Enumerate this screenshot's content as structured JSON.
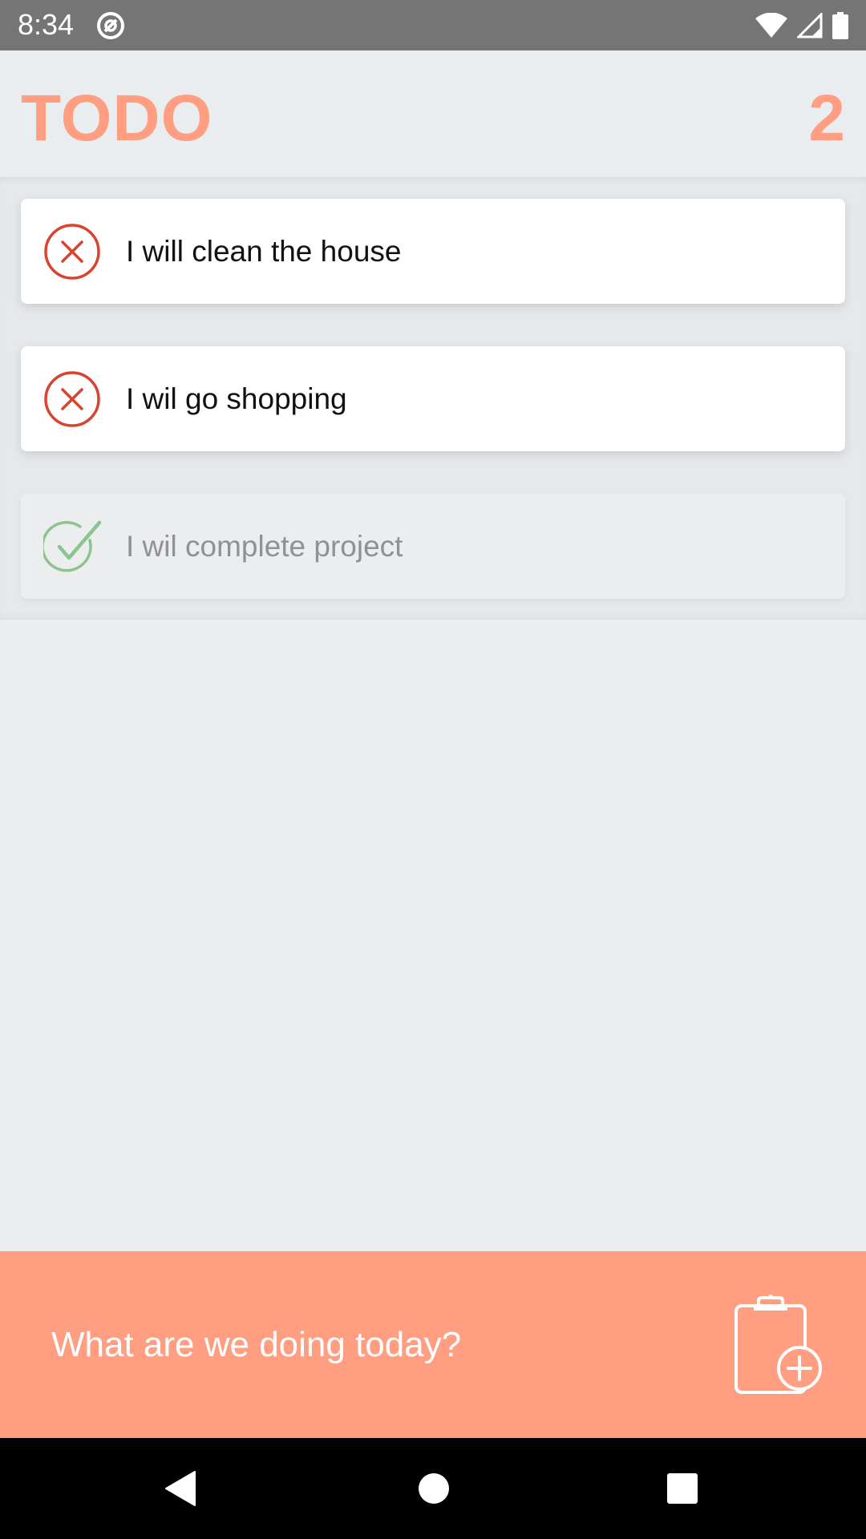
{
  "status_bar": {
    "time": "8:34"
  },
  "header": {
    "title": "TODO",
    "count": "2"
  },
  "todos": [
    {
      "text": "I will clean the house",
      "completed": false,
      "icon": "x-circle-icon"
    },
    {
      "text": "I wil go shopping",
      "completed": false,
      "icon": "x-circle-icon"
    },
    {
      "text": "I wil complete project",
      "completed": true,
      "icon": "check-circle-icon"
    }
  ],
  "input": {
    "placeholder": "What are we doing today?",
    "value": ""
  },
  "colors": {
    "accent": "#ff9e80",
    "pending_icon": "#d9432f",
    "done_icon": "#8cc48e",
    "background": "#e9edf0"
  }
}
